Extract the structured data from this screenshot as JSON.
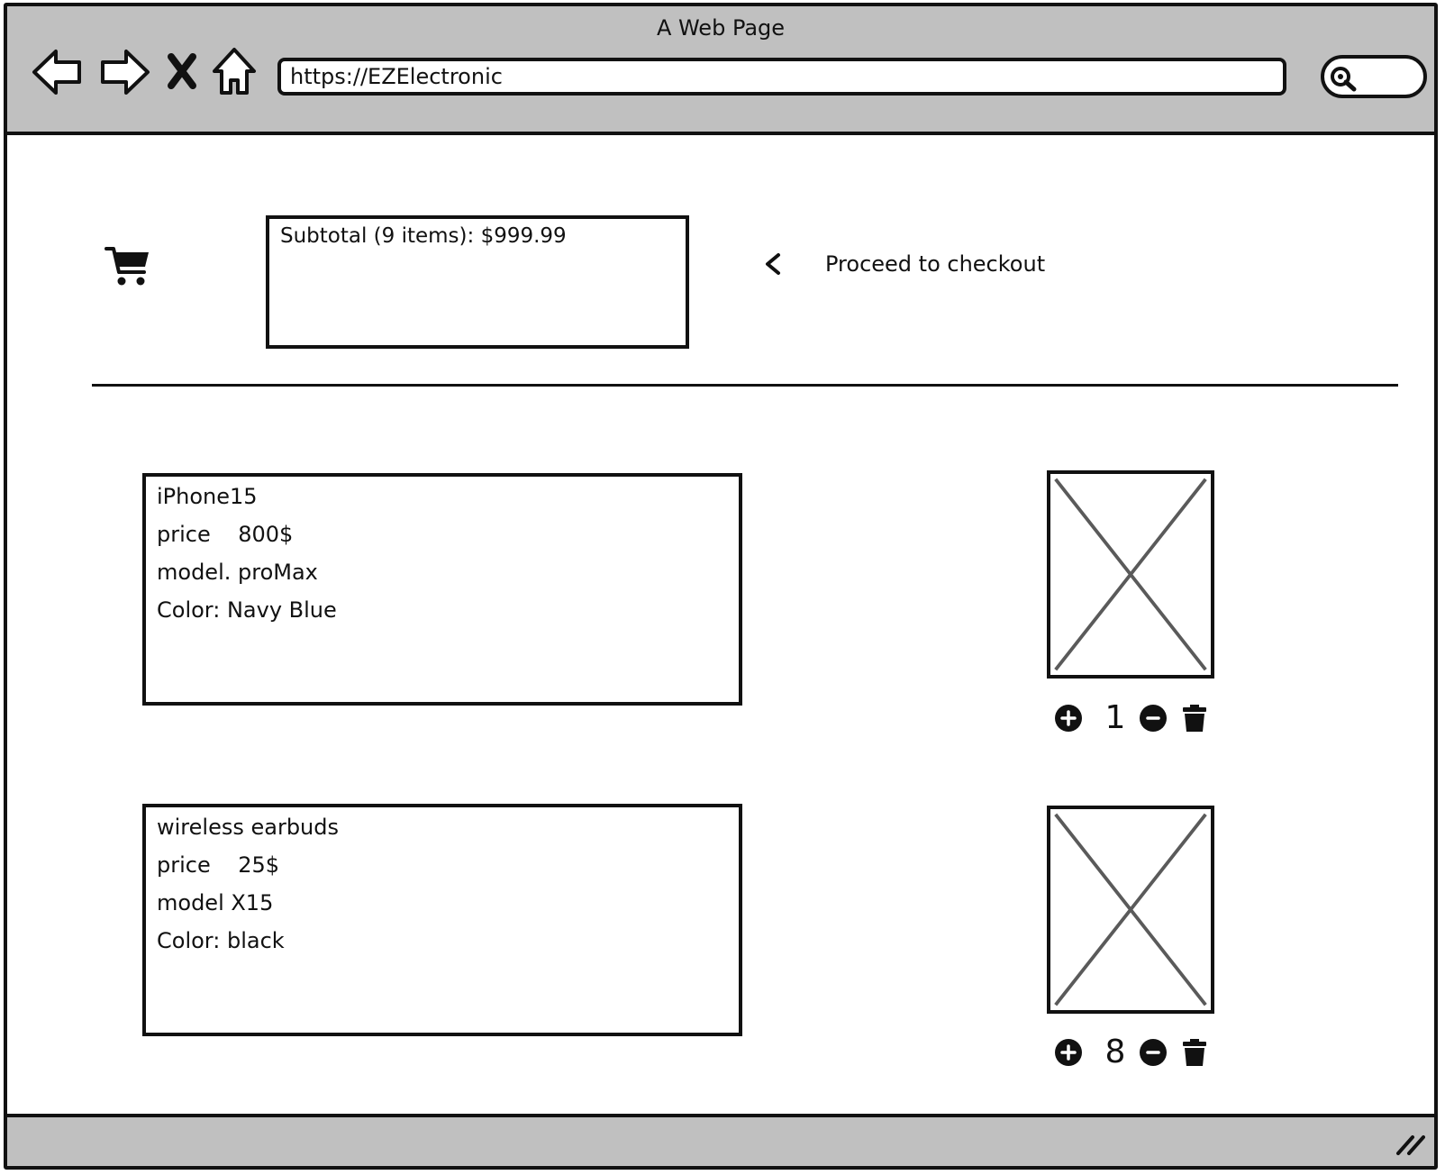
{
  "browser": {
    "window_title": "A Web Page",
    "url": "https://EZElectronic"
  },
  "cart": {
    "subtotal": "Subtotal (9 items): $999.99",
    "checkout_label": "Proceed to checkout"
  },
  "items": [
    {
      "name": "iPhone15",
      "price": "price    800$",
      "model": "model. proMax",
      "color": "Color: Navy Blue",
      "quantity": "1"
    },
    {
      "name": "wireless earbuds",
      "price": "price    25$",
      "model": "model X15",
      "color": "Color: black",
      "quantity": "8"
    }
  ],
  "icons": {
    "back": "back-arrow-icon",
    "forward": "forward-arrow-icon",
    "stop": "close-icon",
    "home": "home-icon",
    "search": "search-icon",
    "cart": "shopping-cart-icon",
    "checkout": "chevron-left-icon",
    "increase": "plus-circle-icon",
    "decrease": "minus-circle-icon",
    "remove": "trash-icon",
    "image": "image-placeholder-icon",
    "resize": "resize-grip-icon"
  },
  "colors": {
    "chrome": "#c0c0c0",
    "ink": "#111111",
    "placeholder_stroke": "#5a5a5a",
    "background": "#ffffff"
  }
}
